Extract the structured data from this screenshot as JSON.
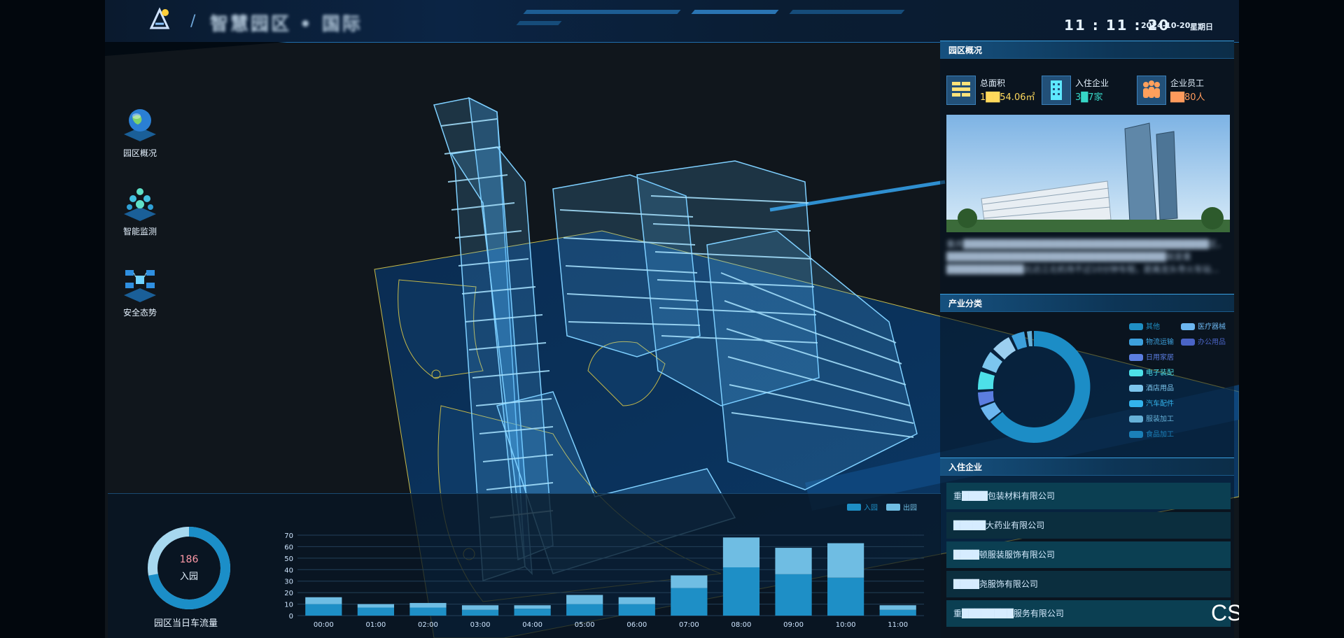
{
  "header": {
    "title": "智慧园区 • 国际",
    "time": "11 : 11 : 20",
    "date": "2024-10-20",
    "weekday": "星期日"
  },
  "nav": [
    {
      "label": "园区概况",
      "icon": "globe-icon"
    },
    {
      "label": "智能监测",
      "icon": "network-cubes-icon"
    },
    {
      "label": "安全态势",
      "icon": "security-network-icon"
    }
  ],
  "overview": {
    "title": "园区概况",
    "stats": [
      {
        "label": "总面积",
        "value": "1██54.06㎡",
        "icon": "brick-wall-icon",
        "color": "#ffd95c"
      },
      {
        "label": "入住企业",
        "value": "3█7家",
        "icon": "building-icon",
        "color": "#36d6c6"
      },
      {
        "label": "企业员工",
        "value": "██80人",
        "icon": "people-icon",
        "color": "#ff9a5c"
      }
    ],
    "intro": "重庆██████████████████████████████████████区，██████████████████████████████████就是重████████████北达江北机场不过10分钟车程，距离龙头寺火车站..."
  },
  "industry": {
    "title": "产业分类",
    "legend": [
      {
        "name": "其他",
        "color": "#1f8fc4"
      },
      {
        "name": "医疗器械",
        "color": "#6cb6ef"
      },
      {
        "name": "物流运输",
        "color": "#3da0dc"
      },
      {
        "name": "办公用品",
        "color": "#4a64c6"
      },
      {
        "name": "日用家居",
        "color": "#5b7de0"
      },
      {
        "name": "电子装配",
        "color": "#4de0e8"
      },
      {
        "name": "酒店用品",
        "color": "#7cc6ee"
      },
      {
        "name": "汽车配件",
        "color": "#33b3ec"
      },
      {
        "name": "服装加工",
        "color": "#66b1d8"
      },
      {
        "name": "食品加工",
        "color": "#1b80b8"
      }
    ]
  },
  "companies": {
    "title": "入住企业",
    "items": [
      "重████包装材料有限公司",
      "█████大药业有限公司",
      "████顿服装服饰有限公司",
      "████尧服饰有限公司",
      "重████████服务有限公司"
    ]
  },
  "traffic": {
    "gauge_value": "186",
    "gauge_label": "入园",
    "gauge_fraction": 0.72,
    "caption": "园区当日车流量"
  },
  "chart_data": {
    "type": "bar",
    "stacked": true,
    "categories": [
      "00:00",
      "01:00",
      "02:00",
      "03:00",
      "04:00",
      "05:00",
      "06:00",
      "07:00",
      "08:00",
      "09:00",
      "10:00",
      "11:00"
    ],
    "series": [
      {
        "name": "入园",
        "values": [
          10,
          7,
          7,
          5,
          6,
          10,
          10,
          24,
          42,
          36,
          33,
          5
        ],
        "color": "#1e8fc6"
      },
      {
        "name": "出园",
        "values": [
          6,
          3,
          4,
          4,
          3,
          8,
          6,
          11,
          26,
          23,
          30,
          4
        ],
        "color": "#6fbde3"
      }
    ],
    "ylim": [
      0,
      70
    ],
    "yticks": [
      0,
      10,
      20,
      30,
      40,
      50,
      60,
      70
    ],
    "legend_position": "top-right",
    "grid": true
  },
  "watermark": "CSDN @QuantSeven"
}
